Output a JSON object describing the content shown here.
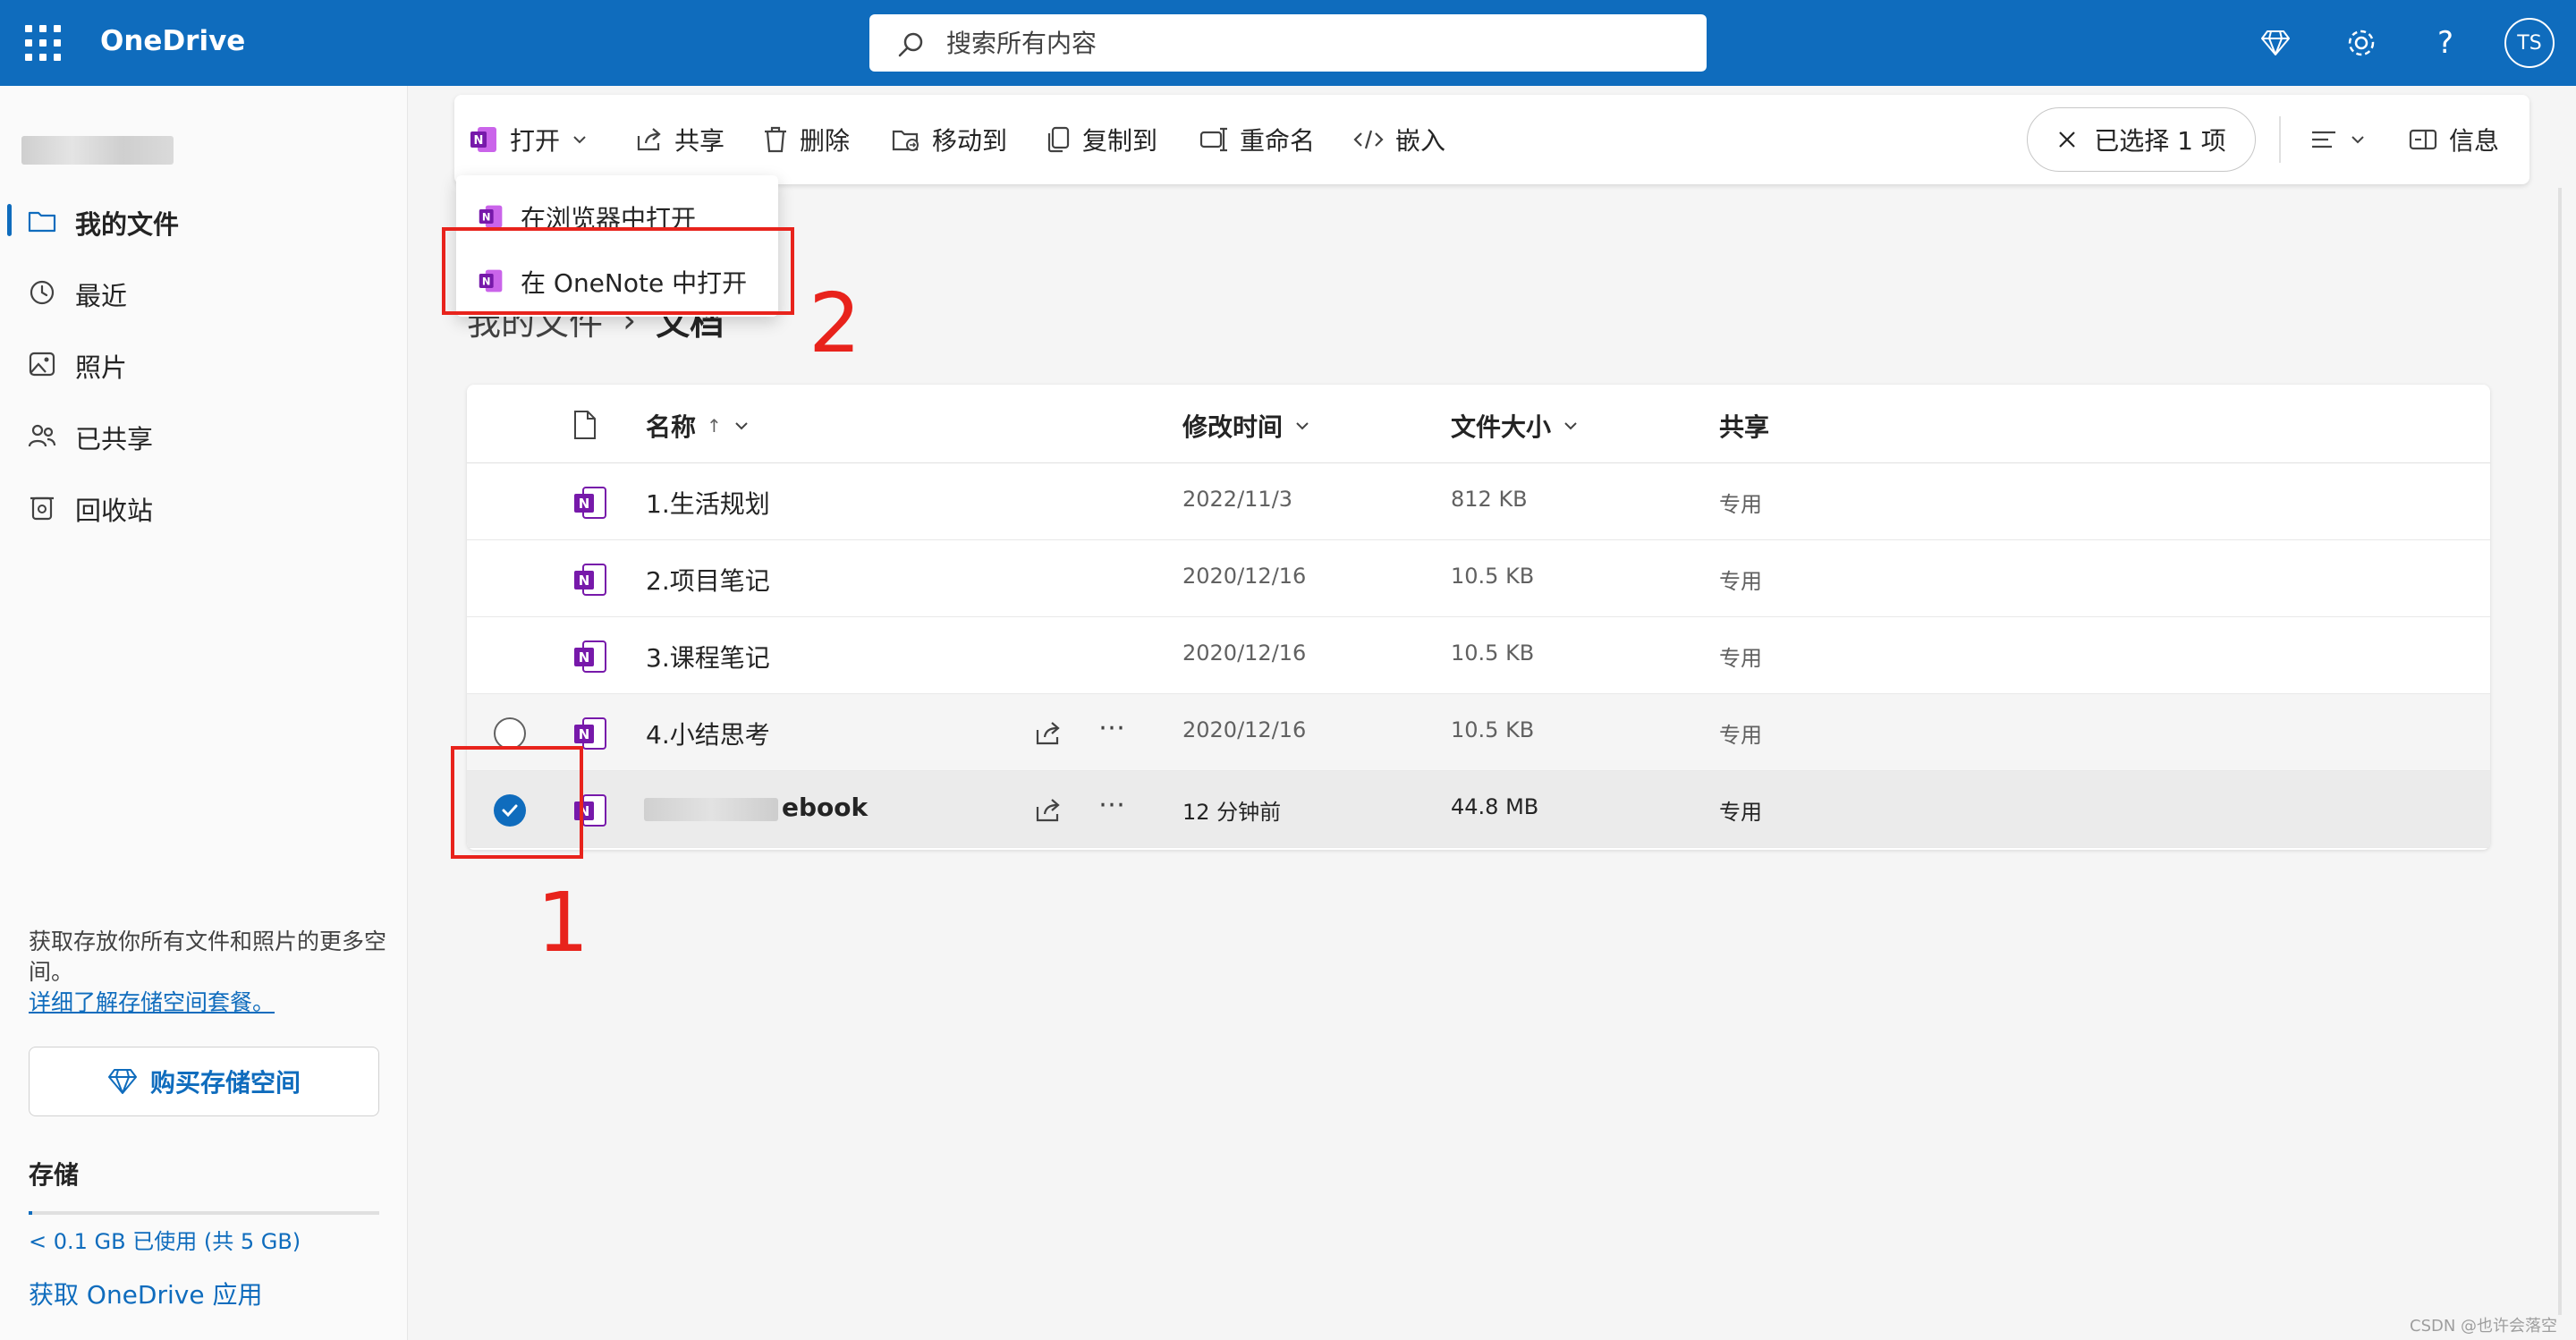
{
  "app": {
    "title": "OneDrive",
    "avatar_initials": "TS"
  },
  "search": {
    "placeholder": "搜索所有内容"
  },
  "sidebar": {
    "items": [
      {
        "label": "我的文件",
        "icon": "folder-icon",
        "active": true
      },
      {
        "label": "最近",
        "icon": "recent-icon"
      },
      {
        "label": "照片",
        "icon": "photo-icon"
      },
      {
        "label": "已共享",
        "icon": "people-icon"
      },
      {
        "label": "回收站",
        "icon": "recycle-bin-icon"
      }
    ],
    "promo_text": "获取存放你所有文件和照片的更多空间。",
    "promo_link": "详细了解存储空间套餐。",
    "buy_button": "购买存储空间",
    "storage_title": "存储",
    "storage_used": "< 0.1 GB 已使用 (共 5 GB)",
    "storage_fraction": 0.01,
    "get_app": "获取 OneDrive 应用"
  },
  "toolbar": {
    "open": "打开",
    "share": "共享",
    "delete": "删除",
    "move_to": "移动到",
    "copy_to": "复制到",
    "rename": "重命名",
    "embed": "嵌入",
    "selected": "已选择 1 项",
    "info": "信息"
  },
  "open_menu": {
    "items": [
      "在浏览器中打开",
      "在 OneNote 中打开"
    ]
  },
  "annotations": {
    "step1": "1",
    "step2": "2"
  },
  "breadcrumb": {
    "parent": "我的文件",
    "separator": "›",
    "current": "文档"
  },
  "table": {
    "headers": {
      "name": "名称",
      "modified": "修改时间",
      "size": "文件大小",
      "sharing": "共享"
    },
    "rows": [
      {
        "name": "1.生活规划",
        "modified": "2022/11/3",
        "size": "812 KB",
        "sharing": "专用"
      },
      {
        "name": "2.项目笔记",
        "modified": "2020/12/16",
        "size": "10.5 KB",
        "sharing": "专用"
      },
      {
        "name": "3.课程笔记",
        "modified": "2020/12/16",
        "size": "10.5 KB",
        "sharing": "专用"
      },
      {
        "name": "4.小结思考",
        "modified": "2020/12/16",
        "size": "10.5 KB",
        "sharing": "专用"
      },
      {
        "name": "ebook",
        "modified": "12 分钟前",
        "size": "44.8 MB",
        "sharing": "专用"
      }
    ]
  },
  "watermark": "CSDN @也许会落空",
  "colors": {
    "brand": "#0f6cbd",
    "onenote": "#7719aa",
    "annotation": "#e8231c"
  }
}
